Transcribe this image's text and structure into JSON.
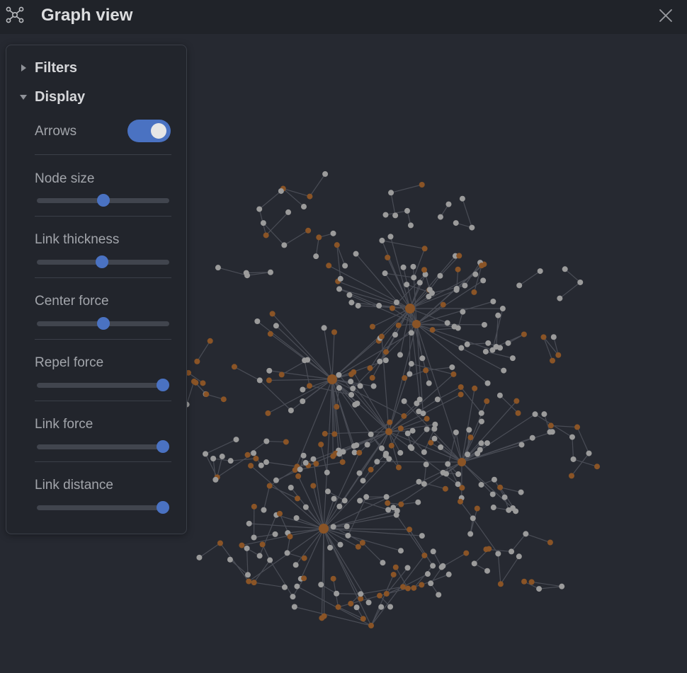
{
  "window": {
    "title": "Graph view",
    "title_icon": "graph-icon",
    "close_icon": "close-icon"
  },
  "colors": {
    "background": "#262931",
    "titlebar": "#202329",
    "accent": "#4a72c2",
    "node_note": "#9b9b9b",
    "node_tag": "#8a5426",
    "link": "#4a4d56"
  },
  "panel": {
    "sections": {
      "filters": {
        "label": "Filters",
        "expanded": false
      },
      "display": {
        "label": "Display",
        "expanded": true
      }
    },
    "arrows": {
      "label": "Arrows",
      "enabled": true
    },
    "sliders": [
      {
        "key": "node_size",
        "label": "Node size",
        "value": 0.5
      },
      {
        "key": "link_thickness",
        "label": "Link thickness",
        "value": 0.49
      },
      {
        "key": "center_force",
        "label": "Center force",
        "value": 0.5
      },
      {
        "key": "repel_force",
        "label": "Repel force",
        "value": 1.0
      },
      {
        "key": "link_force",
        "label": "Link force",
        "value": 1.0
      },
      {
        "key": "link_distance",
        "label": "Link distance",
        "value": 1.0
      }
    ]
  }
}
